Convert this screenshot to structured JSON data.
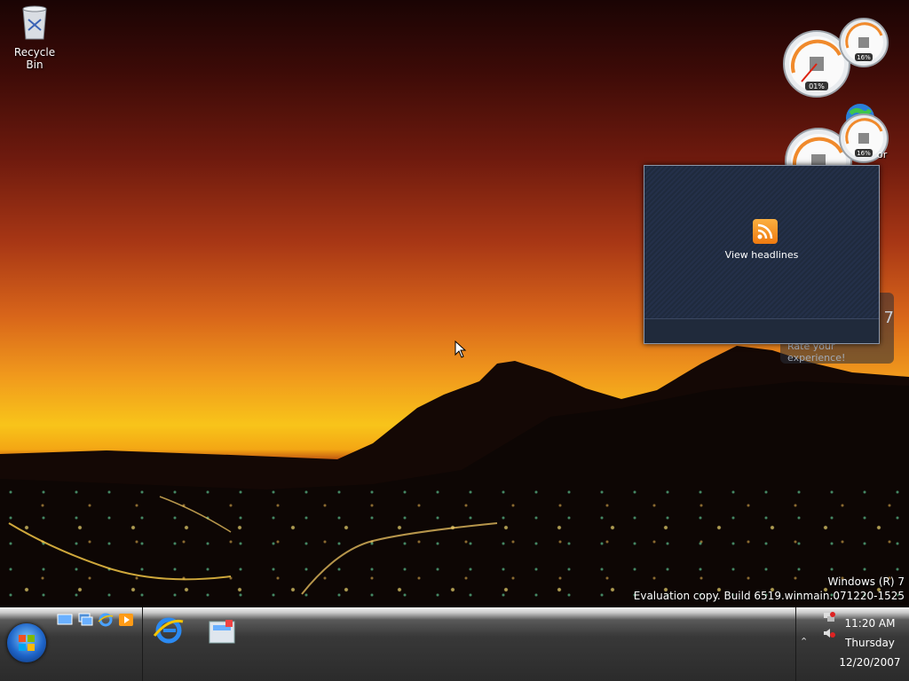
{
  "desktop": {
    "recycle_bin_label": "Recycle Bin",
    "rss_gadget_label": "View headlines",
    "cpu_gauge_top_left": "01%",
    "cpu_gauge_top_right": "16%",
    "cpu_gauge_bottom_right": "16%",
    "gadget_partial_text": "or",
    "rate_gadget_number": "7",
    "rate_gadget_text": "Rate your experience!"
  },
  "watermark": {
    "line1": "Windows (R) 7",
    "line2": "Evaluation copy. Build 6519.winmain.071220-1525"
  },
  "taskbar": {
    "clock_time": "11:20 AM",
    "clock_day": "Thursday",
    "clock_date": "12/20/2007"
  },
  "icons": [
    "recycle-bin-icon",
    "rss-icon",
    "cpu-meter-gauge",
    "globe-icon",
    "windows-logo-icon",
    "show-desktop-icon",
    "switch-windows-icon",
    "internet-explorer-icon",
    "media-player-icon",
    "network-icon",
    "volume-muted-icon",
    "chevron-up-icon",
    "mouse-cursor-icon"
  ],
  "colors": {
    "taskbar": "#2b2b2b",
    "rss_orange": "#f07a10",
    "gadget_bg": "#1f2a3d"
  }
}
